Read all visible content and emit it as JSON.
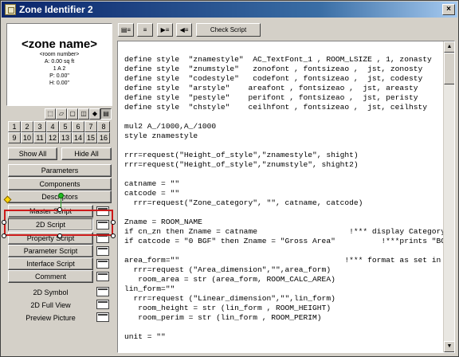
{
  "window": {
    "title": "Zone Identifier 2",
    "close_glyph": "×"
  },
  "preview": {
    "zone_name": "<zone name>",
    "lines": [
      "<room number>",
      "A: 0.00 sq ft",
      "1 A 2",
      "P: 0.00\"",
      "H: 0.00\""
    ]
  },
  "view_icons": [
    "⬚",
    "▱",
    "▢",
    "◫",
    "◆",
    "▤"
  ],
  "number_buttons": [
    "1",
    "2",
    "3",
    "4",
    "5",
    "6",
    "7",
    "8",
    "9",
    "10",
    "11",
    "12",
    "13",
    "14",
    "15",
    "16"
  ],
  "show_all": "Show All",
  "hide_all": "Hide All",
  "panel_buttons": {
    "parameters": "Parameters",
    "components": "Components",
    "descriptors": "Descriptors",
    "master_script": "Master Script",
    "script_2d": "2D Script",
    "property_script": "Property Script",
    "parameter_script": "Parameter Script",
    "interface_script": "Interface Script",
    "comment": "Comment"
  },
  "panel_labels": {
    "symbol_2d": "2D Symbol",
    "full_view_2d": "2D Full View",
    "preview_picture": "Preview Picture"
  },
  "toolbar": {
    "t1": "▤≡",
    "t2": "≡",
    "t3": "▶≡",
    "t4": "◀≡",
    "check_script": "Check Script"
  },
  "script_lines": [
    "define style  \"znamestyle\"  AC_TextFont_1 , ROOM_LSIZE , 1, zonasty",
    "define style  \"znumstyle\"   zonofont , fontsizeao ,  jst, zonosty",
    "define style  \"codestyle\"   codefont , fontsizeao ,  jst, codesty",
    "define style  \"arstyle\"    areafont , fontsizeao ,  jst, areasty",
    "define style  \"pestyle\"    perifont , fontsizeao ,  jst, peristy",
    "define style  \"chstyle\"    ceilhfont , fontsizeao ,  jst, ceilhsty",
    "",
    "mul2 A_/1000,A_/1000",
    "style znamestyle",
    "",
    "rrr=request(\"Height_of_style\",\"znamestyle\", shight)",
    "rrr=request(\"Height_of_style\",\"znumstyle\", shight2)",
    "",
    "catname = \"\"",
    "catcode = \"\"",
    "  rrr=request(\"Zone_category\", \"\", catname, catcode)",
    "",
    "Zname = ROOM_NAME",
    "if cn_zn then Zname = catname                    !*** display Category Na",
    "if catcode = \"0 BGF\" then Zname = \"Gross Area\"          !***prints \"BGF\"",
    "",
    "area_form=\"\"                                    !*** format as set in th",
    "  rrr=request (\"Area_dimension\",\"\",area_form)",
    "   room_area = str (area_form, ROOM_CALC_AREA)",
    "lin_form=\"\"",
    "  rrr=request (\"Linear_dimension\",\"\",lin_form)",
    "   room_height = str (lin_form , ROOM_HEIGHT)",
    "   room_perim = str (lin_form , ROOM_PERIM)",
    "",
    "unit = \"\""
  ],
  "scrollbar": {
    "up": "▲",
    "down": "▼"
  }
}
